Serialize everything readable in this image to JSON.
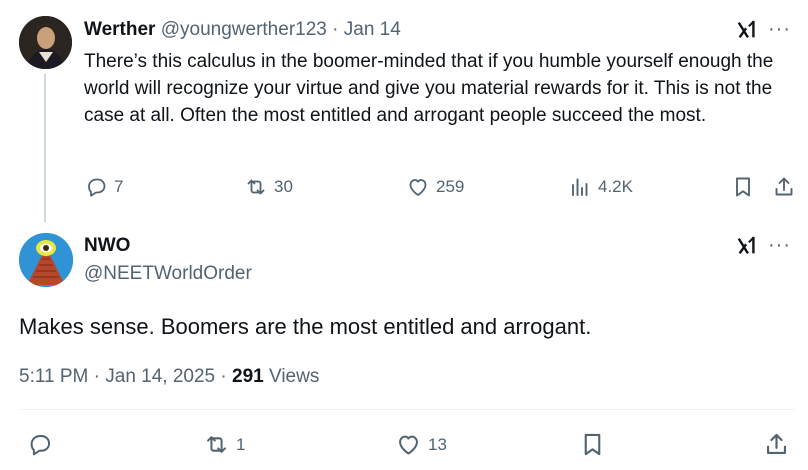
{
  "parent_tweet": {
    "display_name": "Werther",
    "handle": "@youngwerther123",
    "separator": "·",
    "date": "Jan 14",
    "text": "There’s this calculus in the boomer-minded that if you humble yourself enough the world will recognize your virtue and give you material rewards for it. This is not the case at all. Often the most entitled and arrogant people succeed the most.",
    "replies": "7",
    "reposts": "30",
    "likes": "259",
    "views": "4.2K",
    "more_label": "···"
  },
  "main_tweet": {
    "display_name": "NWO",
    "handle": "@NEETWorldOrder",
    "text": "Makes sense. Boomers are the most entitled and arrogant.",
    "time": "5:11 PM",
    "separator": "·",
    "date": "Jan 14, 2025",
    "views_count": "291",
    "views_label": "Views",
    "reposts": "1",
    "likes": "13",
    "more_label": "···"
  },
  "colors": {
    "text": "#0f1419",
    "muted": "#536471",
    "thread_line": "#cfd9de",
    "divider": "#eff3f4"
  },
  "icons": [
    "grok-icon",
    "more-icon",
    "reply-icon",
    "repost-icon",
    "like-icon",
    "views-icon",
    "bookmark-icon",
    "share-icon"
  ]
}
